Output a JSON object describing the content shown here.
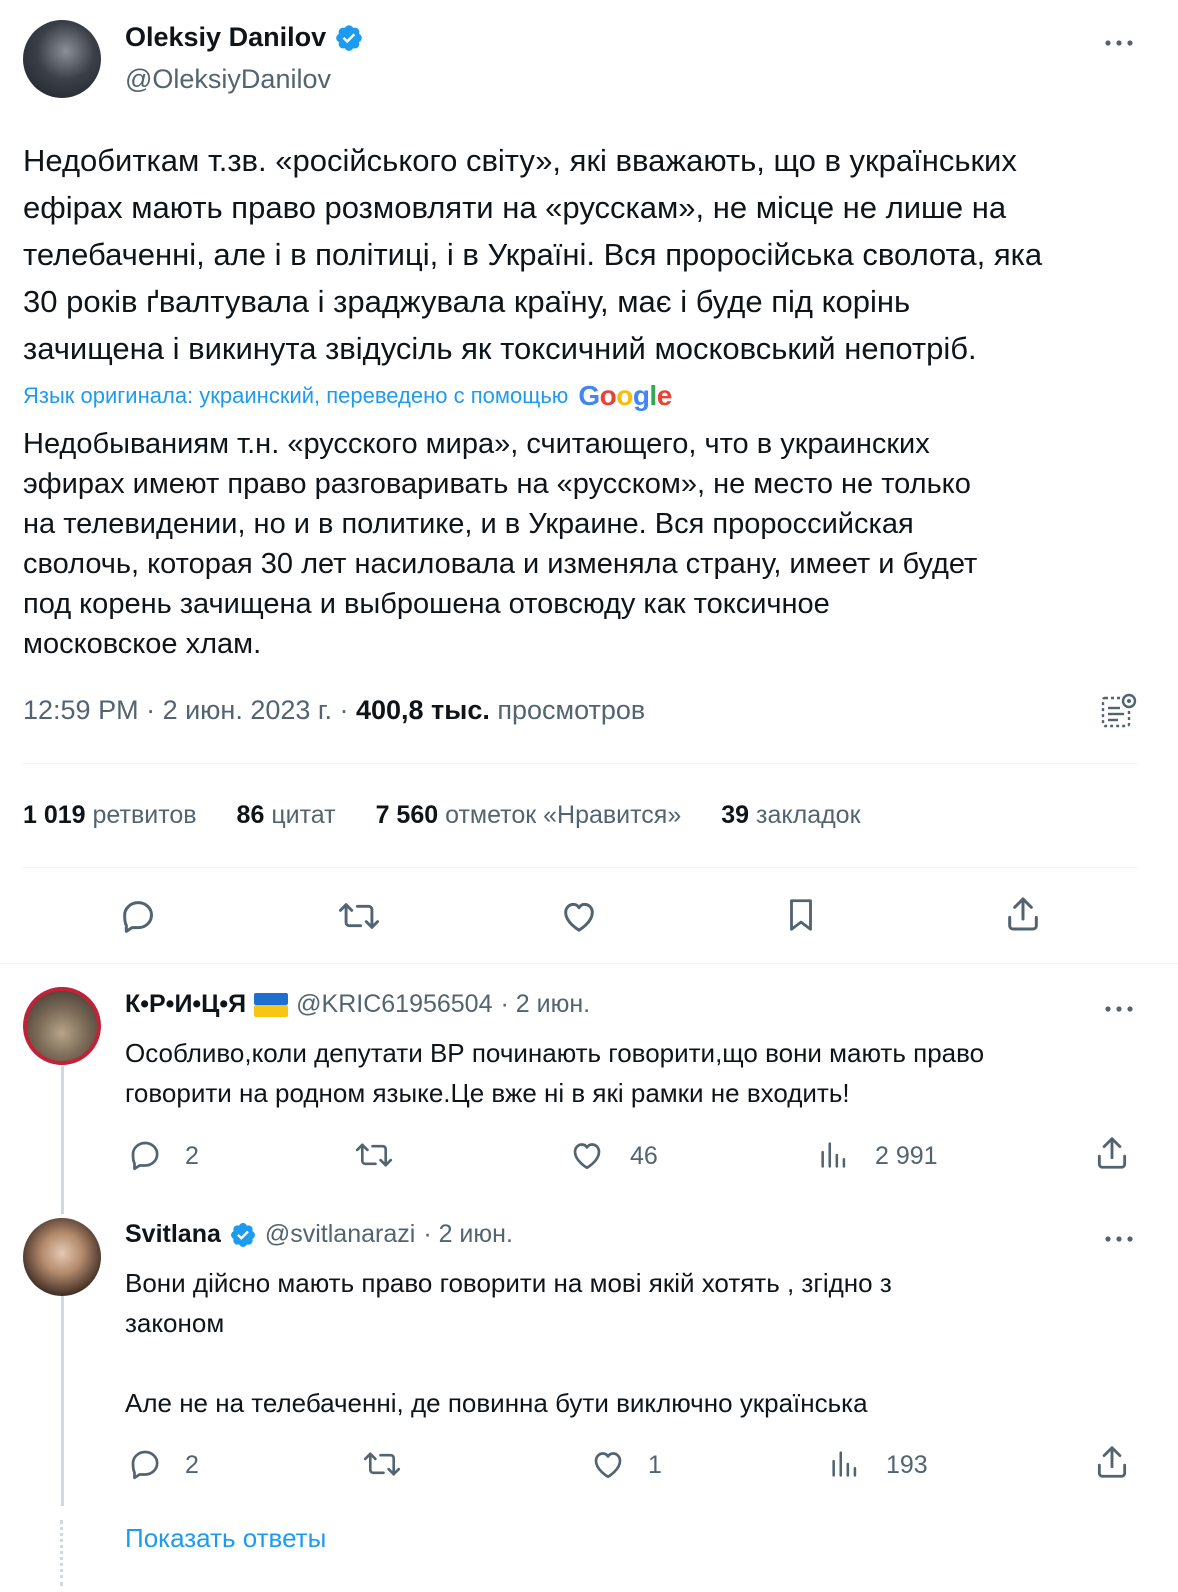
{
  "tweet": {
    "author_name": "Oleksiy Danilov",
    "author_handle": "@OleksiyDanilov",
    "text_lines": [
      "Недобиткам т.зв. «російського світу», які вважають, що в українських",
      "ефірах мають право розмовляти на «русскам», не місце не лише на",
      "телебаченні, але і в політиці, і в Україні. Вся проросійська сволота, яка",
      "30 років ґвалтувала і зраджувала країну, має і буде під корінь",
      "зачищена і викинута звідусіль як токсичний московський непотріб."
    ],
    "translation_note": "Язык оригинала: украинский, переведено с помощью",
    "translation_provider": "Google",
    "translated_lines": [
      "Недобываниям т.н. «русского мира», считающего, что в украинских",
      "эфирах имеют право разговаривать на «русском», не место не только",
      "на телевидении, но и в политике, и в Украине. Вся пророссийская",
      "сволочь, которая 30 лет насиловала и изменяла страну, имеет и будет",
      "под корень зачищена и выброшена отовсюду как токсичное",
      "московское хлам."
    ],
    "time": "12:59 PM",
    "date": "2 июн. 2023 г.",
    "views_count": "400,8 тыс.",
    "views_label": "просмотров",
    "retweets_count": "1 019",
    "retweets_label": "ретвитов",
    "quotes_count": "86",
    "quotes_label": "цитат",
    "likes_count": "7 560",
    "likes_label": "отметок «Нравится»",
    "bookmarks_count": "39",
    "bookmarks_label": "закладок"
  },
  "replies": [
    {
      "name": "К•Р•И•Ц•Я",
      "flag": "ukraine-flag",
      "handle": "@KRIC61956504",
      "date": "· 2 июн.",
      "lines": [
        "Особливо,коли депутати ВР починають говорити,що вони мають право",
        "говорити на родном языке.Це вже ні в які рамки не входить!"
      ],
      "replies": "2",
      "retweets": "",
      "likes": "46",
      "views": "2 991"
    },
    {
      "name": "Svitlana",
      "handle": "@svitlanarazi",
      "date": "· 2 июн.",
      "lines": [
        "Вони дійсно мають право говорити на мові якій хотять , згідно з",
        "законом",
        "",
        "Але не на телебаченні, де повинна бути виключно українська"
      ],
      "replies": "2",
      "retweets": "",
      "likes": "1",
      "views": "193"
    }
  ],
  "show_replies": "Показать ответы",
  "colors": {
    "accent": "#1d9bf0",
    "text": "#0f1419",
    "secondary": "#536471",
    "divider": "#eff3f4"
  }
}
